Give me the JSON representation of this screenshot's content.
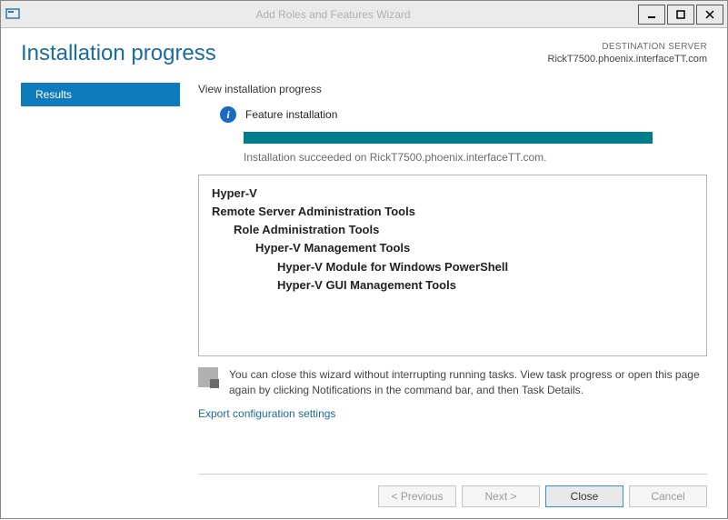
{
  "window": {
    "title": "Add Roles and Features Wizard",
    "controls": {
      "min": "▁",
      "max": "▢",
      "close": "✕"
    }
  },
  "header": {
    "title": "Installation progress",
    "destination_label": "DESTINATION SERVER",
    "destination_name": "RickT7500.phoenix.interfaceTT.com"
  },
  "sidebar": {
    "items": [
      {
        "label": "Results",
        "selected": true
      }
    ]
  },
  "progress": {
    "section_label": "View installation progress",
    "feature_label": "Feature installation",
    "status_text": "Installation succeeded on RickT7500.phoenix.interfaceTT.com."
  },
  "tree": {
    "items": [
      {
        "label": "Hyper-V",
        "indent": 0,
        "bold": true
      },
      {
        "label": "Remote Server Administration Tools",
        "indent": 0,
        "bold": true
      },
      {
        "label": "Role Administration Tools",
        "indent": 1,
        "bold": true
      },
      {
        "label": "Hyper-V Management Tools",
        "indent": 2,
        "bold": true
      },
      {
        "label": "Hyper-V Module for Windows PowerShell",
        "indent": 3,
        "bold": true
      },
      {
        "label": "Hyper-V GUI Management Tools",
        "indent": 3,
        "bold": true
      }
    ]
  },
  "note": {
    "text": "You can close this wizard without interrupting running tasks. View task progress or open this page again by clicking Notifications in the command bar, and then Task Details."
  },
  "links": {
    "export": "Export configuration settings"
  },
  "buttons": {
    "previous": "< Previous",
    "next": "Next >",
    "close": "Close",
    "cancel": "Cancel"
  }
}
